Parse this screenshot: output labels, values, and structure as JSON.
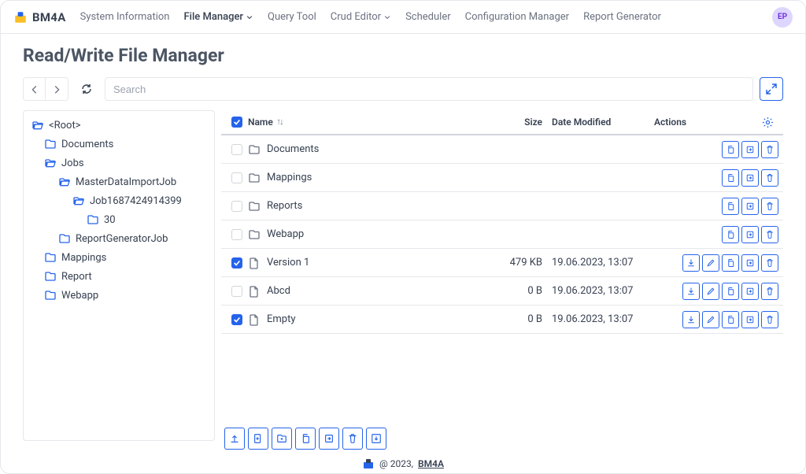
{
  "brand": "BM4A",
  "nav": {
    "items": [
      {
        "label": "System Information"
      },
      {
        "label": "File Manager",
        "active": true,
        "dropdown": true
      },
      {
        "label": "Query Tool"
      },
      {
        "label": "Crud Editor",
        "dropdown": true
      },
      {
        "label": "Scheduler"
      },
      {
        "label": "Configuration Manager"
      },
      {
        "label": "Report Generator"
      }
    ]
  },
  "avatar": "EP",
  "page_title": "Read/Write File Manager",
  "search_placeholder": "Search",
  "tree": [
    {
      "label": "<Root>",
      "depth": 0,
      "open": true
    },
    {
      "label": "Documents",
      "depth": 1
    },
    {
      "label": "Jobs",
      "depth": 1,
      "open": true
    },
    {
      "label": "MasterDataImportJob",
      "depth": 2,
      "open": true
    },
    {
      "label": "Job1687424914399",
      "depth": 3,
      "open": true
    },
    {
      "label": "30",
      "depth": 4
    },
    {
      "label": "ReportGeneratorJob",
      "depth": 2
    },
    {
      "label": "Mappings",
      "depth": 1
    },
    {
      "label": "Report",
      "depth": 1
    },
    {
      "label": "Webapp",
      "depth": 1
    }
  ],
  "columns": {
    "name": "Name",
    "size": "Size",
    "date": "Date Modified",
    "actions": "Actions"
  },
  "header_checked": true,
  "rows": [
    {
      "name": "Documents",
      "type": "folder",
      "checked": false,
      "size": "",
      "date": ""
    },
    {
      "name": "Mappings",
      "type": "folder",
      "checked": false,
      "size": "",
      "date": ""
    },
    {
      "name": "Reports",
      "type": "folder",
      "checked": false,
      "size": "",
      "date": ""
    },
    {
      "name": "Webapp",
      "type": "folder",
      "checked": false,
      "size": "",
      "date": ""
    },
    {
      "name": "Version 1",
      "type": "file",
      "checked": true,
      "size": "479 KB",
      "date": "19.06.2023, 13:07"
    },
    {
      "name": "Abcd",
      "type": "file",
      "checked": false,
      "size": "0 B",
      "date": "19.06.2023, 13:07"
    },
    {
      "name": "Empty",
      "type": "file",
      "checked": true,
      "size": "0 B",
      "date": "19.06.2023, 13:07"
    }
  ],
  "footer": {
    "copyright": "@ 2023,",
    "brand": "BM4A"
  }
}
